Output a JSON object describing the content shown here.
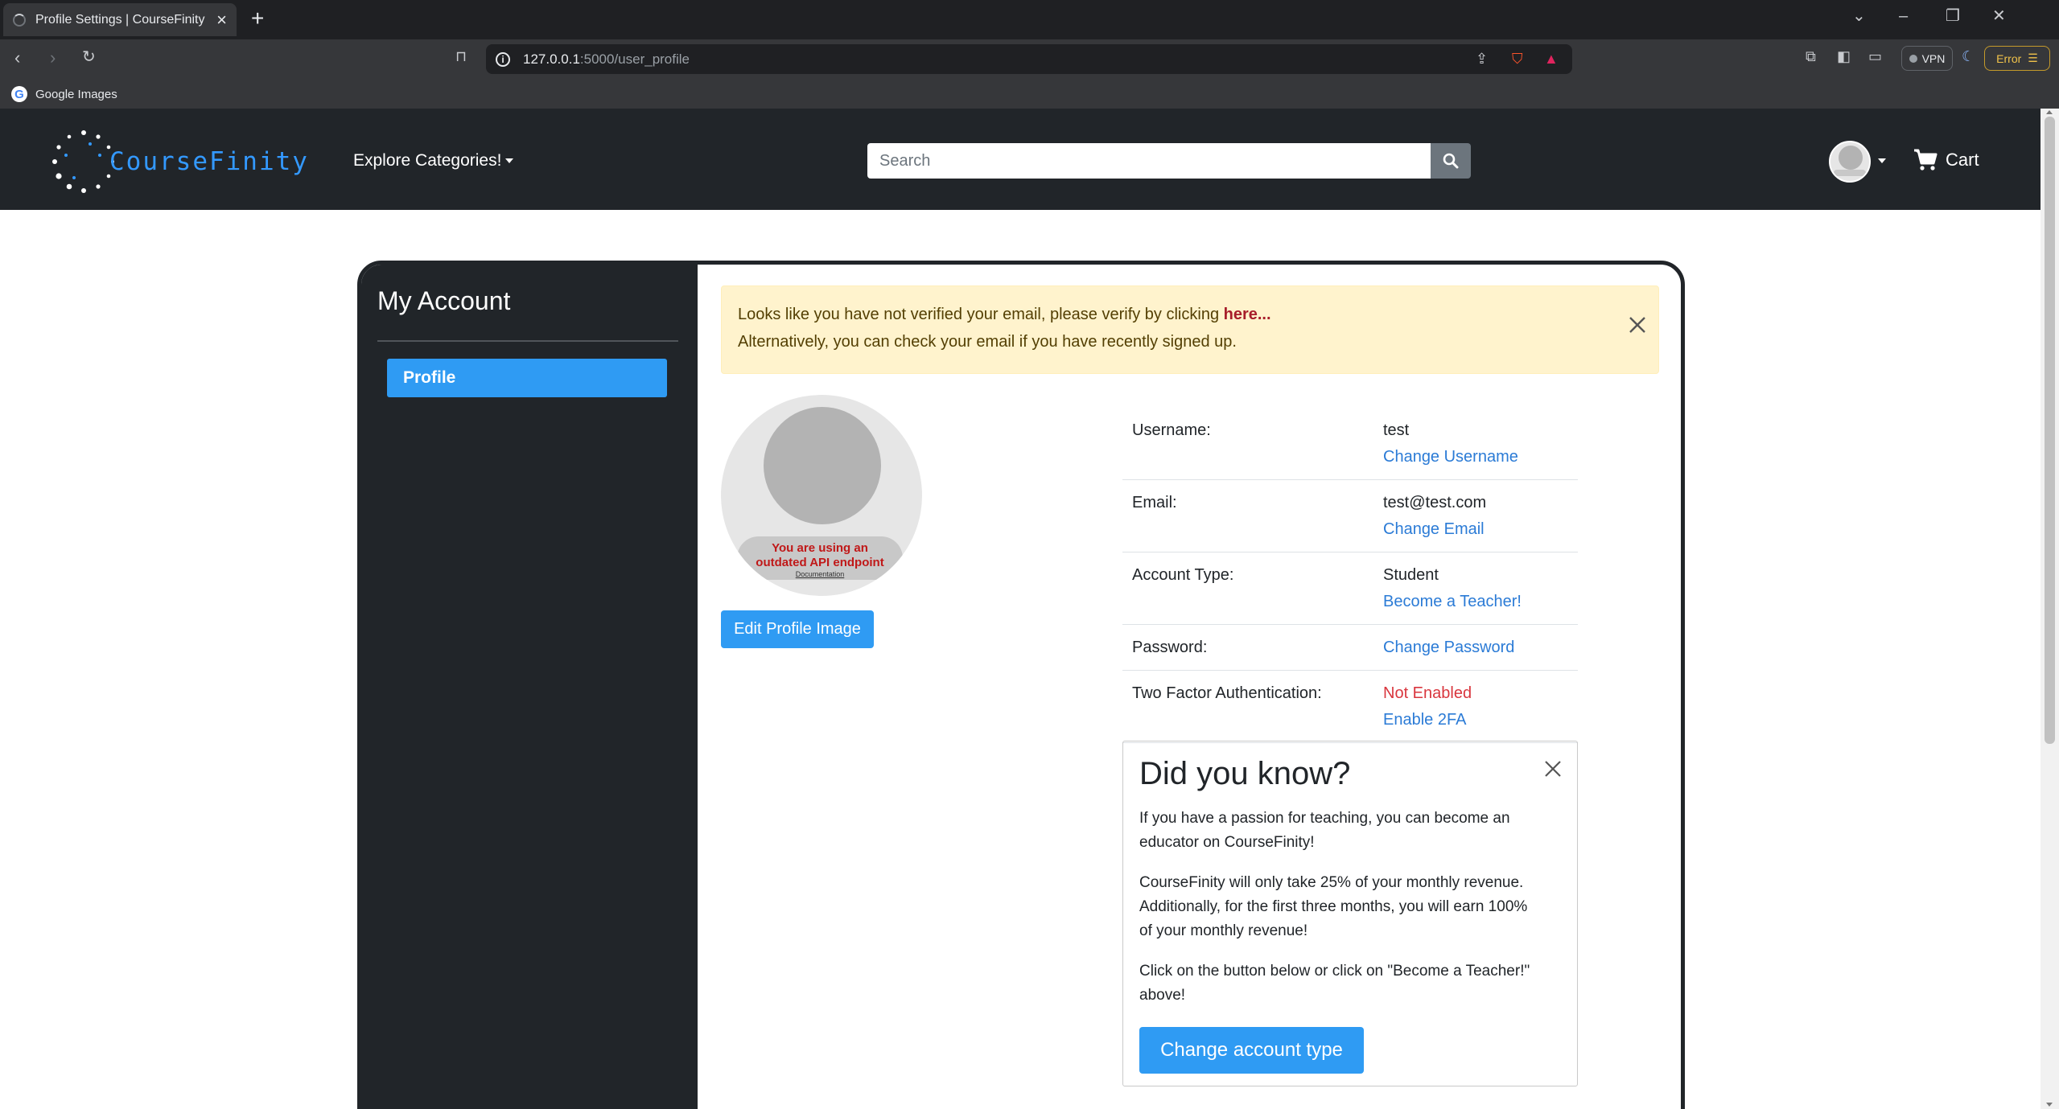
{
  "browser": {
    "tab_title": "Profile Settings | CourseFinity",
    "url_host": "127.0.0.1",
    "url_rest": ":5000/user_profile",
    "bookmark": "Google Images",
    "vpn_label": "VPN",
    "error_label": "Error"
  },
  "site": {
    "brand": "CourseFinity",
    "explore_label": "Explore Categories!",
    "search_placeholder": "Search",
    "cart_label": "Cart",
    "brand_color": "#3399ff"
  },
  "sidebar": {
    "title": "My Account",
    "items": [
      {
        "label": "Profile",
        "active": true
      }
    ]
  },
  "alert": {
    "line1_text": "Looks like you have not verified your email, please verify by clicking ",
    "line1_link": "here...",
    "line2": "Alternatively, you can check your email if you have recently signed up."
  },
  "profile_image": {
    "warning_line1": "You are using an",
    "warning_line2": "outdated API endpoint",
    "doc_link": "Documentation",
    "edit_button": "Edit Profile Image"
  },
  "details": {
    "username_label": "Username:",
    "username_value": "test",
    "username_action": "Change Username",
    "email_label": "Email:",
    "email_value": "test@test.com",
    "email_action": "Change Email",
    "account_type_label": "Account Type:",
    "account_type_value": "Student",
    "account_type_action": "Become a Teacher!",
    "password_label": "Password:",
    "password_action": "Change Password",
    "twofa_label": "Two Factor Authentication:",
    "twofa_status": "Not Enabled",
    "twofa_action": "Enable 2FA"
  },
  "did_you_know": {
    "title": "Did you know?",
    "para1": "If you have a passion for teaching, you can become an educator on CourseFinity!",
    "para2": "CourseFinity will only take 25% of your monthly revenue. Additionally, for the first three months, you will earn 100% of your monthly revenue!",
    "para3": "Click on the button below or click on \"Become a Teacher!\" above!",
    "button": "Change account type"
  }
}
